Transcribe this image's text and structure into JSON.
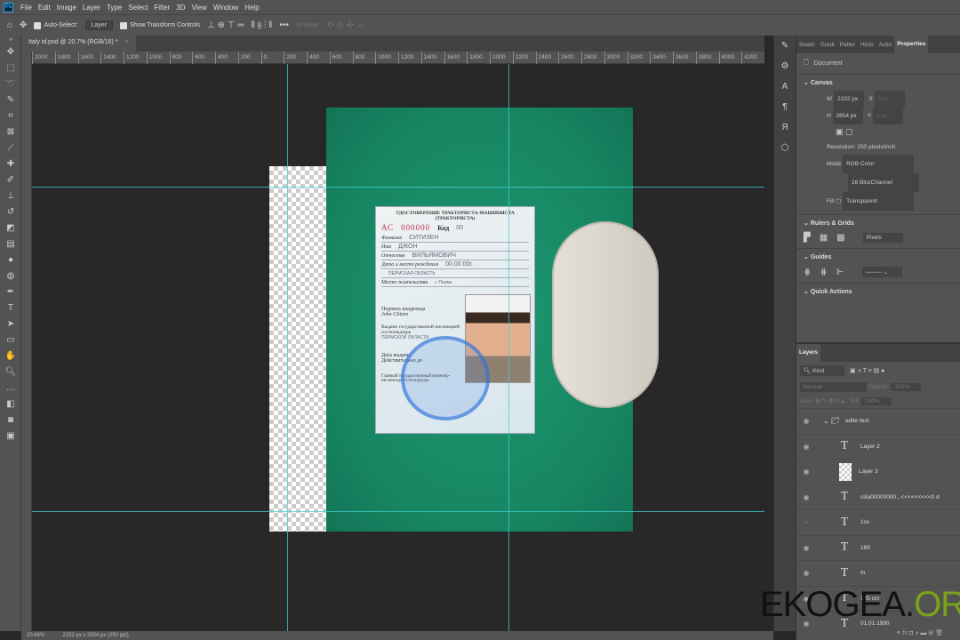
{
  "menu": {
    "logo": "Ps",
    "items": [
      "File",
      "Edit",
      "Image",
      "Layer",
      "Type",
      "Select",
      "Filter",
      "3D",
      "View",
      "Window",
      "Help"
    ]
  },
  "options": {
    "auto_select": "Auto-Select:",
    "auto_select_target": "Layer",
    "show_transform": "Show Transform Controls",
    "mode_3d": "3D Mode:"
  },
  "document_tab": {
    "title": "Italy id.psd @ 20.7% (RGB/16) *",
    "close": "×"
  },
  "ruler_ticks": [
    "2000",
    "1800",
    "1600",
    "1400",
    "1200",
    "1000",
    "800",
    "600",
    "400",
    "200",
    "0",
    "200",
    "400",
    "600",
    "800",
    "1000",
    "1200",
    "1400",
    "1600",
    "1800",
    "2000",
    "2200",
    "2400",
    "2600",
    "2800",
    "3000",
    "3200",
    "3400",
    "3600",
    "3800",
    "4000",
    "4200"
  ],
  "card": {
    "title1": "УДОСТОВЕРЕНИЕ ТРАКТОРИСТА-МАШИНИСТА",
    "title2": "(ТРАКТОРИСТА)",
    "series": "АС",
    "number": "000000",
    "code_label": "Код",
    "code": "00",
    "rows": [
      {
        "label": "Фамилия",
        "value": "СИТИЗЕН"
      },
      {
        "label": "Имя",
        "value": "ДЖОН"
      },
      {
        "label": "Отчество",
        "value": "ВИЛЬЯМОВИЧ"
      },
      {
        "label": "Дата и место рождения",
        "value": "00.00.00г."
      },
      {
        "label": "",
        "value": "ПЕРМСКАЯ ОБЛАСТЬ"
      },
      {
        "label": "Место жительства",
        "value": "г. Пермь"
      }
    ],
    "signature_label": "Подпись владельца",
    "signature": "John Citizen",
    "issued_label": "Выдано государственной инспекцией гостехнадзора",
    "issued_value": "ПЕРМСКОЙ ОБЛАСТИ",
    "date_label": "Дата выдачи",
    "valid_label": "Действительно до",
    "chief": "Главный государственный инженер-инспектор гостехнадзора"
  },
  "properties": {
    "tabs": [
      "Swatc",
      "Gradi",
      "Patter",
      "Histo",
      "Actio",
      "Properties"
    ],
    "doc_label": "Document",
    "canvas_section": "Canvas",
    "w_label": "W",
    "w": "2232 px",
    "h_label": "H",
    "h": "2854 px",
    "x_label": "X",
    "x": "0 px",
    "y_label": "Y",
    "y": "0 px",
    "resolution": "Resolution: 250 pixels/inch",
    "mode_label": "Mode",
    "mode": "RGB Color",
    "depth": "16 Bits/Channel",
    "fill_label": "Fill",
    "fill": "Transparent",
    "rulers_section": "Rulers & Grids",
    "units": "Pixels",
    "guides_section": "Guides",
    "quick_actions": "Quick Actions"
  },
  "layers": {
    "tab": "Layers",
    "kind": "Kind",
    "blend": "Normal",
    "opacity_label": "Opacity:",
    "opacity": "100%",
    "lock_label": "Lock:",
    "fill_label": "Fill:",
    "fill": "100%",
    "items": [
      {
        "name": "edite text",
        "type": "group",
        "visible": true
      },
      {
        "name": "Layer 2",
        "type": "text",
        "visible": true
      },
      {
        "name": "Layer 3",
        "type": "image",
        "visible": true
      },
      {
        "name": "cilia00000000...<<<<<<<<<0 d",
        "type": "text",
        "visible": true
      },
      {
        "name": "1ss",
        "type": "text",
        "visible": false
      },
      {
        "name": "169",
        "type": "text",
        "visible": true
      },
      {
        "name": "m",
        "type": "text",
        "visible": true
      },
      {
        "name": "125 cm",
        "type": "text",
        "visible": true
      },
      {
        "name": "01.01.1990",
        "type": "text",
        "visible": true
      }
    ]
  },
  "status": {
    "zoom": "20.66%",
    "doc_info": "2232 px x 2854 px (250 ppi)"
  },
  "watermark": {
    "main": "EKOGEA.",
    "accent": "ORG"
  },
  "colors": {
    "guide": "#3fd0d8",
    "panel": "#535353",
    "canvas_bg": "#282828",
    "photo": "#178562"
  }
}
